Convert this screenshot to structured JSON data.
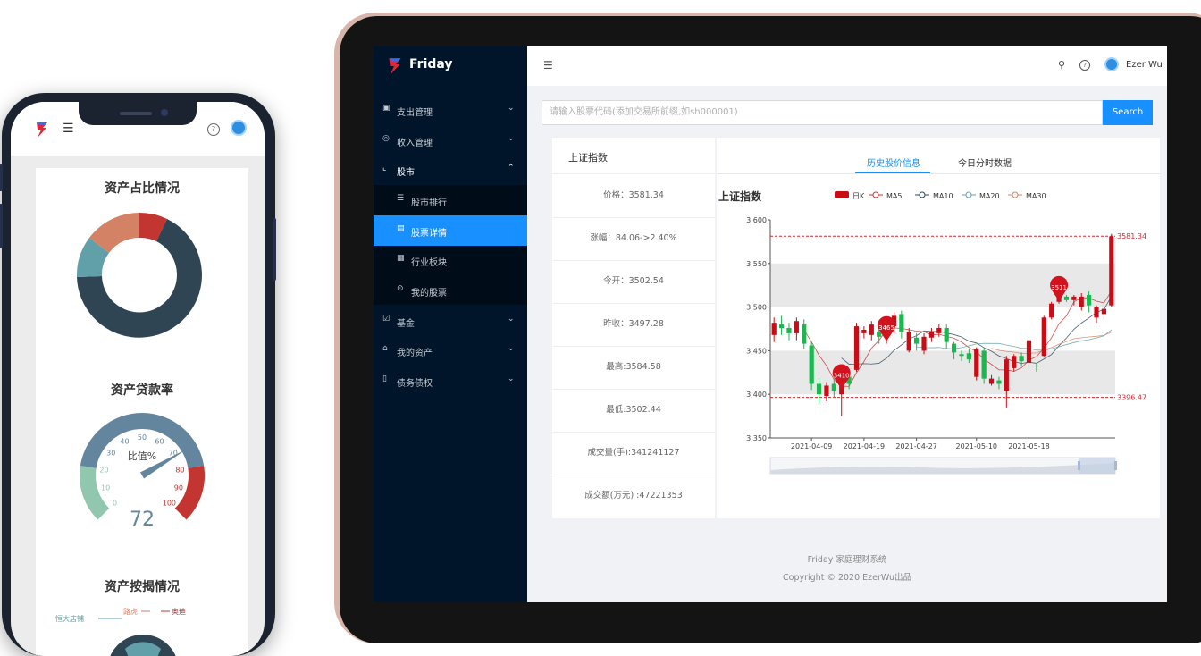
{
  "phone": {
    "charts": [
      {
        "title": "资产占比情况"
      },
      {
        "title": "资产贷款率",
        "gauge_label": "比值%",
        "value_text": "72",
        "value": 72,
        "ticks": [
          "0",
          "10",
          "20",
          "30",
          "40",
          "50",
          "60",
          "70",
          "80",
          "90",
          "100"
        ]
      },
      {
        "title": "资产按揭情况",
        "labels": [
          "恒大店铺",
          "路虎",
          "奥迪"
        ]
      }
    ]
  },
  "app": {
    "brand": "Friday",
    "user": "Ezer Wu",
    "menu": [
      {
        "label": "支出管理",
        "icon": "wallet-icon",
        "arrow": "⌄"
      },
      {
        "label": "收入管理",
        "icon": "income-icon",
        "arrow": "⌄"
      },
      {
        "label": "股市",
        "icon": "chart-line-icon",
        "arrow": "⌃"
      },
      {
        "label": "股市排行",
        "icon": "ordered-list-icon"
      },
      {
        "label": "股票详情",
        "icon": "profile-icon"
      },
      {
        "label": "行业板块",
        "icon": "appstore-icon"
      },
      {
        "label": "我的股票",
        "icon": "star-circle-icon"
      },
      {
        "label": "基金",
        "icon": "fund-icon",
        "arrow": "⌄"
      },
      {
        "label": "我的资产",
        "icon": "bank-icon",
        "arrow": "⌄"
      },
      {
        "label": "债务债权",
        "icon": "document-icon",
        "arrow": "⌄"
      }
    ],
    "search": {
      "placeholder": "请输入股票代码(添加交易所前缀,如sh000001)",
      "button": "Search"
    },
    "info": {
      "title": "上证指数",
      "rows": [
        "价格：3581.34",
        "涨幅：84.06->2.40%",
        "今开：3502.54",
        "昨收：3497.28",
        "最高:3584.58",
        "最低:3502.44",
        "成交量(手):341241127",
        "成交额(万元) :47221353"
      ]
    },
    "tabs": [
      "历史股价信息",
      "今日分时数据"
    ],
    "footer": {
      "line1": "Friday 家庭理财系统",
      "line2": "Copyright © 2020 EzerWu出品"
    }
  },
  "colors": {
    "sidebar": "#001529",
    "primary": "#1890ff",
    "up": "#c90d17",
    "down": "#1ab84e"
  },
  "chart_data": {
    "type": "candlestick",
    "title": "上证指数",
    "legend": [
      "日K",
      "MA5",
      "MA10",
      "MA20",
      "MA30"
    ],
    "ylim": [
      3350,
      3600
    ],
    "yticks": [
      "3,350",
      "3,400",
      "3,450",
      "3,500",
      "3,550",
      "3,600"
    ],
    "xticks": [
      "2021-04-09",
      "2021-04-19",
      "2021-04-27",
      "2021-05-10",
      "2021-05-18"
    ],
    "markLines": [
      3581.34,
      3396.47
    ],
    "markPoints": [
      3410,
      3465,
      3511
    ],
    "series": [
      {
        "name": "日K",
        "values": [
          [
            3468,
            3482,
            3460,
            3488
          ],
          [
            3480,
            3476,
            3468,
            3490
          ],
          [
            3476,
            3470,
            3462,
            3482
          ],
          [
            3470,
            3484,
            3462,
            3488
          ],
          [
            3480,
            3458,
            3452,
            3486
          ],
          [
            3456,
            3412,
            3405,
            3460
          ],
          [
            3412,
            3400,
            3390,
            3418
          ],
          [
            3398,
            3410,
            3392,
            3414
          ],
          [
            3412,
            3404,
            3396,
            3418
          ],
          [
            3400,
            3420,
            3375,
            3424
          ],
          [
            3420,
            3412,
            3406,
            3426
          ],
          [
            3428,
            3478,
            3426,
            3482
          ],
          [
            3470,
            3474,
            3464,
            3478
          ],
          [
            3468,
            3480,
            3462,
            3484
          ],
          [
            3472,
            3466,
            3458,
            3478
          ],
          [
            3465,
            3470,
            3458,
            3474
          ],
          [
            3478,
            3490,
            3470,
            3494
          ],
          [
            3492,
            3472,
            3464,
            3496
          ],
          [
            3450,
            3472,
            3448,
            3476
          ],
          [
            3465,
            3458,
            3450,
            3470
          ],
          [
            3450,
            3466,
            3446,
            3470
          ],
          [
            3465,
            3472,
            3460,
            3476
          ],
          [
            3470,
            3476,
            3466,
            3480
          ],
          [
            3476,
            3460,
            3452,
            3480
          ],
          [
            3458,
            3448,
            3440,
            3460
          ],
          [
            3446,
            3444,
            3438,
            3450
          ],
          [
            3447,
            3440,
            3436,
            3452
          ],
          [
            3420,
            3452,
            3416,
            3454
          ],
          [
            3450,
            3418,
            3412,
            3454
          ],
          [
            3412,
            3418,
            3410,
            3422
          ],
          [
            3416,
            3412,
            3406,
            3420
          ],
          [
            3404,
            3440,
            3385,
            3444
          ],
          [
            3430,
            3444,
            3426,
            3446
          ],
          [
            3444,
            3438,
            3432,
            3448
          ],
          [
            3436,
            3462,
            3432,
            3466
          ],
          [
            3433,
            3432,
            3426,
            3436
          ],
          [
            3444,
            3488,
            3442,
            3490
          ],
          [
            3488,
            3504,
            3486,
            3506
          ],
          [
            3506,
            3518,
            3504,
            3520
          ],
          [
            3512,
            3508,
            3506,
            3514
          ],
          [
            3508,
            3512,
            3502,
            3514
          ],
          [
            3500,
            3512,
            3496,
            3516
          ],
          [
            3514,
            3502,
            3494,
            3518
          ],
          [
            3488,
            3500,
            3482,
            3502
          ],
          [
            3492,
            3498,
            3486,
            3502
          ],
          [
            3502,
            3581,
            3500,
            3584
          ]
        ]
      }
    ]
  }
}
